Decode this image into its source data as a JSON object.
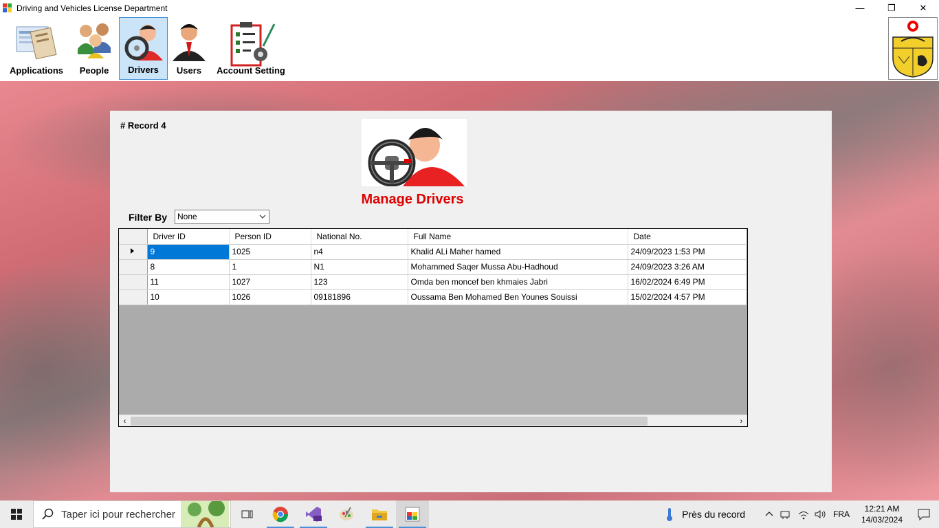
{
  "window": {
    "title": "Driving and Vehicles License Department",
    "controls": [
      "—",
      "❐",
      "✕"
    ]
  },
  "toolbar": {
    "items": [
      {
        "label": "Applications",
        "icon": "applications-icon"
      },
      {
        "label": "People",
        "icon": "people-icon"
      },
      {
        "label": "Drivers",
        "icon": "driver-icon",
        "active": true
      },
      {
        "label": "Users",
        "icon": "user-icon"
      },
      {
        "label": "Account Setting",
        "icon": "account-settings-icon"
      }
    ],
    "emblem": "tunisia-coat-of-arms"
  },
  "panel": {
    "record_count": "# Record 4",
    "title": "Manage Drivers",
    "filter_label": "Filter By",
    "filter_value": "None"
  },
  "grid": {
    "columns": [
      "Driver ID",
      "Person ID",
      "National No.",
      "Full Name",
      "Date"
    ],
    "rows": [
      [
        "9",
        "1025",
        "n4",
        "Khalid ALi Maher hamed",
        "24/09/2023 1:53 PM"
      ],
      [
        "8",
        "1",
        "N1",
        "Mohammed Saqer Mussa Abu-Hadhoud",
        "24/09/2023 3:26 AM"
      ],
      [
        "11",
        "1027",
        "123",
        "Omda ben moncef ben khmaies Jabri",
        "16/02/2024 6:49 PM"
      ],
      [
        "10",
        "1026",
        "09181896",
        "Oussama Ben Mohamed Ben Younes Souissi",
        "15/02/2024 4:57 PM"
      ]
    ],
    "selected_row": 0,
    "scroll_left": "‹",
    "scroll_right": "›"
  },
  "taskbar": {
    "search_placeholder": "Taper ici pour rechercher",
    "weather": "Près du record",
    "language": "FRA",
    "time": "12:21 AM",
    "date": "14/03/2024"
  },
  "colors": {
    "title_red": "#e00000",
    "selection_blue": "#0078d7",
    "active_tab": "#cce4f7"
  }
}
